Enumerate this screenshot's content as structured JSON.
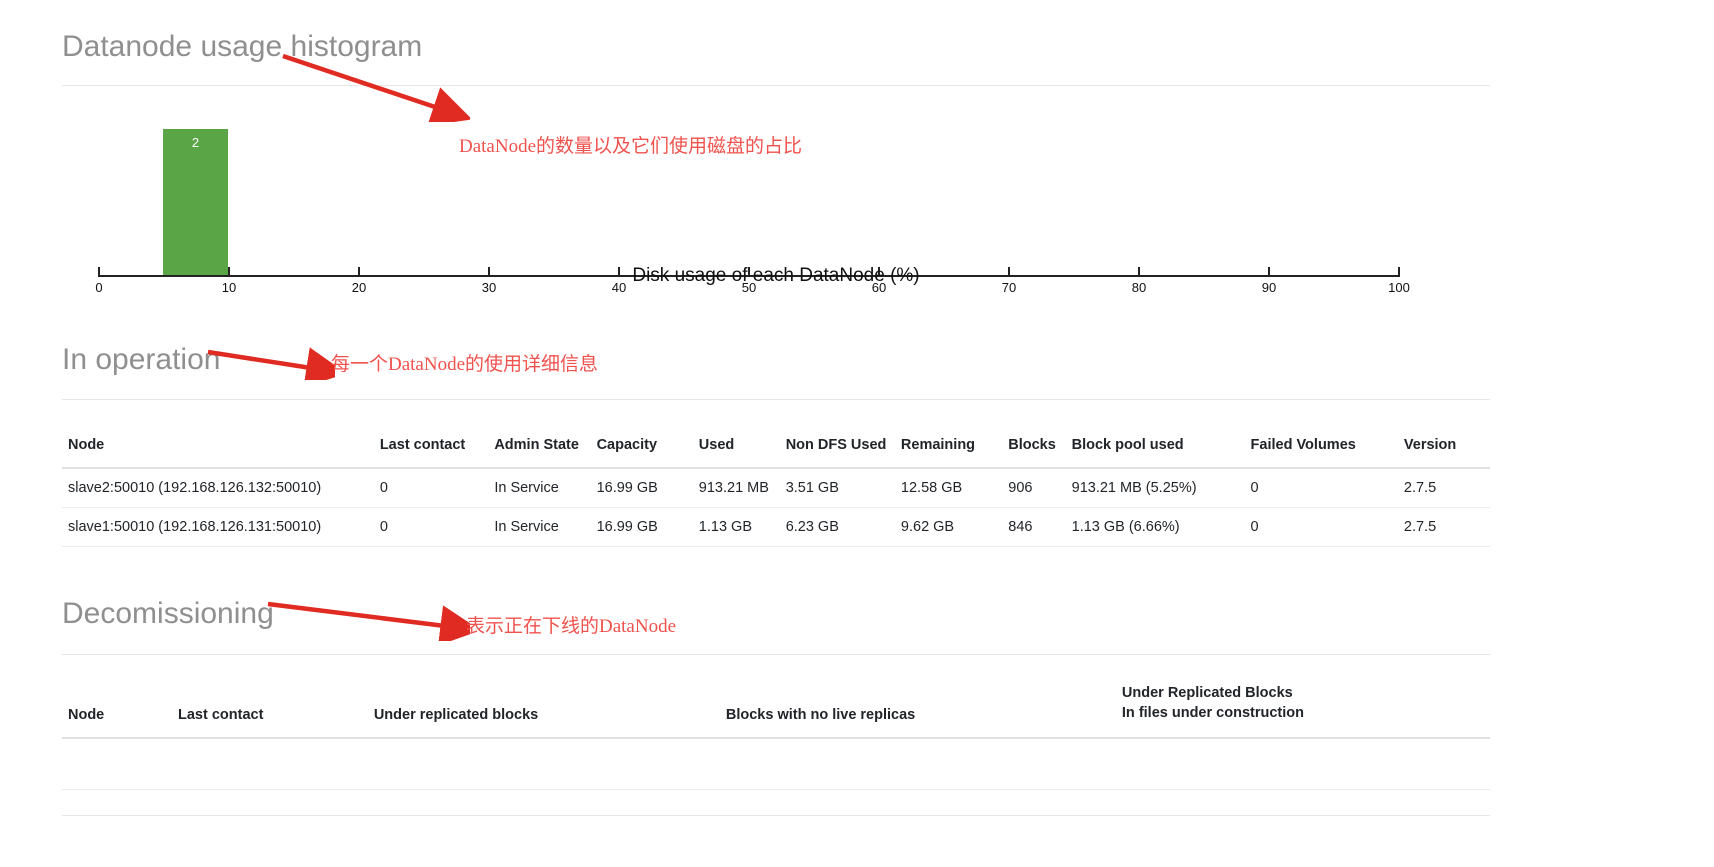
{
  "sections": {
    "histogram_title": "Datanode usage histogram",
    "in_operation_title": "In operation",
    "decommissioning_title": "Decomissioning"
  },
  "chart_data": {
    "type": "bar",
    "title": "Datanode usage histogram",
    "xlabel": "Disk usage of each DataNode (%)",
    "ylabel": "",
    "xlim": [
      0,
      100
    ],
    "grid": false,
    "legend": "none",
    "tick_labels": [
      "0",
      "10",
      "20",
      "30",
      "40",
      "50",
      "60",
      "70",
      "80",
      "90",
      "100"
    ],
    "tick_values": [
      0,
      10,
      20,
      30,
      40,
      50,
      60,
      70,
      80,
      90,
      100
    ],
    "bars": [
      {
        "bin_start": 5,
        "bin_end": 10,
        "value": 2,
        "label": "2",
        "color": "#5aa545"
      }
    ],
    "categories": [
      "5-10"
    ],
    "values": [
      2
    ]
  },
  "in_operation_table": {
    "headers": [
      "Node",
      "Last contact",
      "Admin State",
      "Capacity",
      "Used",
      "Non DFS Used",
      "Remaining",
      "Blocks",
      "Block pool used",
      "Failed Volumes",
      "Version"
    ],
    "rows": [
      {
        "node": "slave2:50010 (192.168.126.132:50010)",
        "last_contact": "0",
        "admin_state": "In Service",
        "capacity": "16.99 GB",
        "used": "913.21 MB",
        "non_dfs_used": "3.51 GB",
        "remaining": "12.58 GB",
        "blocks": "906",
        "block_pool_used": "913.21 MB (5.25%)",
        "failed_volumes": "0",
        "version": "2.7.5"
      },
      {
        "node": "slave1:50010 (192.168.126.131:50010)",
        "last_contact": "0",
        "admin_state": "In Service",
        "capacity": "16.99 GB",
        "used": "1.13 GB",
        "non_dfs_used": "6.23 GB",
        "remaining": "9.62 GB",
        "blocks": "846",
        "block_pool_used": "1.13 GB (6.66%)",
        "failed_volumes": "0",
        "version": "2.7.5"
      }
    ]
  },
  "decommissioning_table": {
    "headers": [
      "Node",
      "Last contact",
      "Under replicated blocks",
      "Blocks with no live replicas",
      "Under Replicated Blocks\nIn files under construction"
    ],
    "header_last_line1": "Under Replicated Blocks",
    "header_last_line2": "In files under construction",
    "rows": []
  },
  "annotations": [
    {
      "text": "DataNode的数量以及它们使用磁盘的占比",
      "color": "#f0524d"
    },
    {
      "text": "每一个DataNode的使用详细信息",
      "color": "#f0524d"
    },
    {
      "text": "表示正在下线的DataNode",
      "color": "#f0524d"
    }
  ],
  "colors": {
    "bar": "#5aa545",
    "annotation": "#f0524d",
    "heading": "#8f8f8f",
    "divider": "#e7e7e7"
  }
}
